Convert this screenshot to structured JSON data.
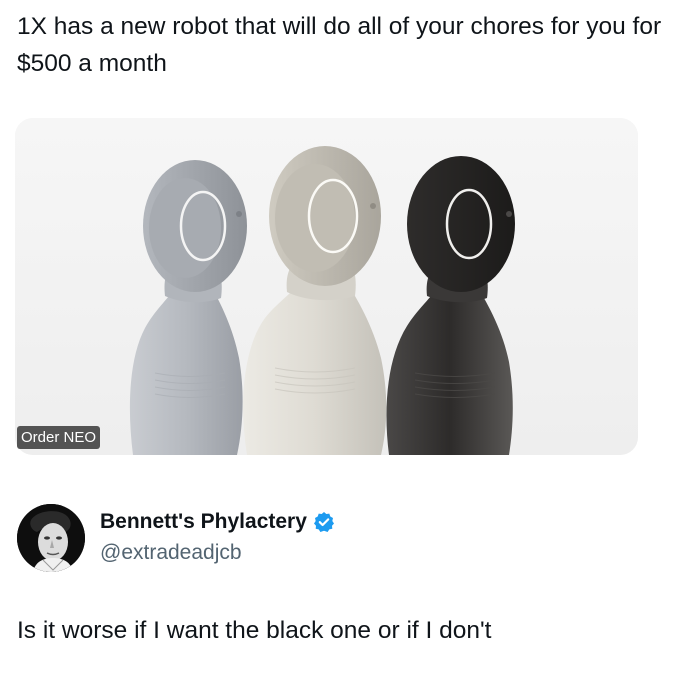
{
  "quoted_post": {
    "text": "1X has a new robot that will do all of your chores for you for $500 a month",
    "media": {
      "badge_label": "Order NEO",
      "robot_colors": [
        "#b9bdc3",
        "#d8d5cc",
        "#2b2928"
      ]
    }
  },
  "author": {
    "display_name": "Bennett's Phylactery",
    "handle": "@extradeadjcb",
    "verified": true,
    "verified_color": "#1d9bf0"
  },
  "post": {
    "text": "Is it worse if I want the black one or if I don't"
  }
}
